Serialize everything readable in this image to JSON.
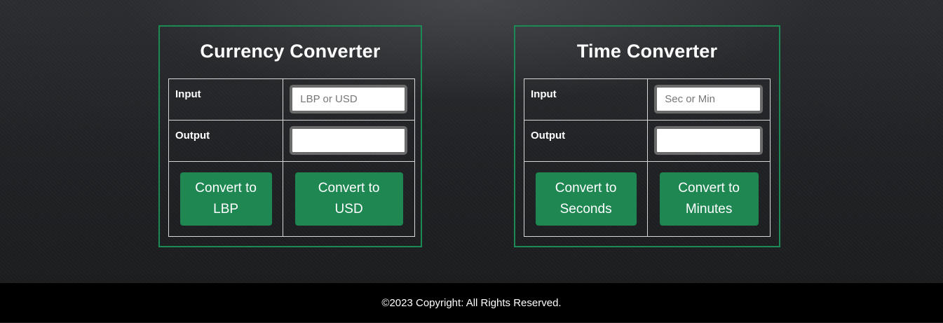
{
  "currency": {
    "title": "Currency Converter",
    "input_label": "Input",
    "input_placeholder": "LBP or USD",
    "input_value": "",
    "output_label": "Output",
    "output_value": "",
    "btn_lbp_line1": "Convert to",
    "btn_lbp_line2": "LBP",
    "btn_usd_line1": "Convert to",
    "btn_usd_line2": "USD"
  },
  "time": {
    "title": "Time Converter",
    "input_label": "Input",
    "input_placeholder": "Sec or Min",
    "input_value": "",
    "output_label": "Output",
    "output_value": "",
    "btn_sec_line1": "Convert to",
    "btn_sec_line2": "Seconds",
    "btn_min_line1": "Convert to",
    "btn_min_line2": "Minutes"
  },
  "footer": {
    "copyright": "©2023 Copyright: All Rights Reserved."
  },
  "colors": {
    "accent": "#1e8752",
    "border": "#1d8a55",
    "footer_bg": "#000000"
  }
}
